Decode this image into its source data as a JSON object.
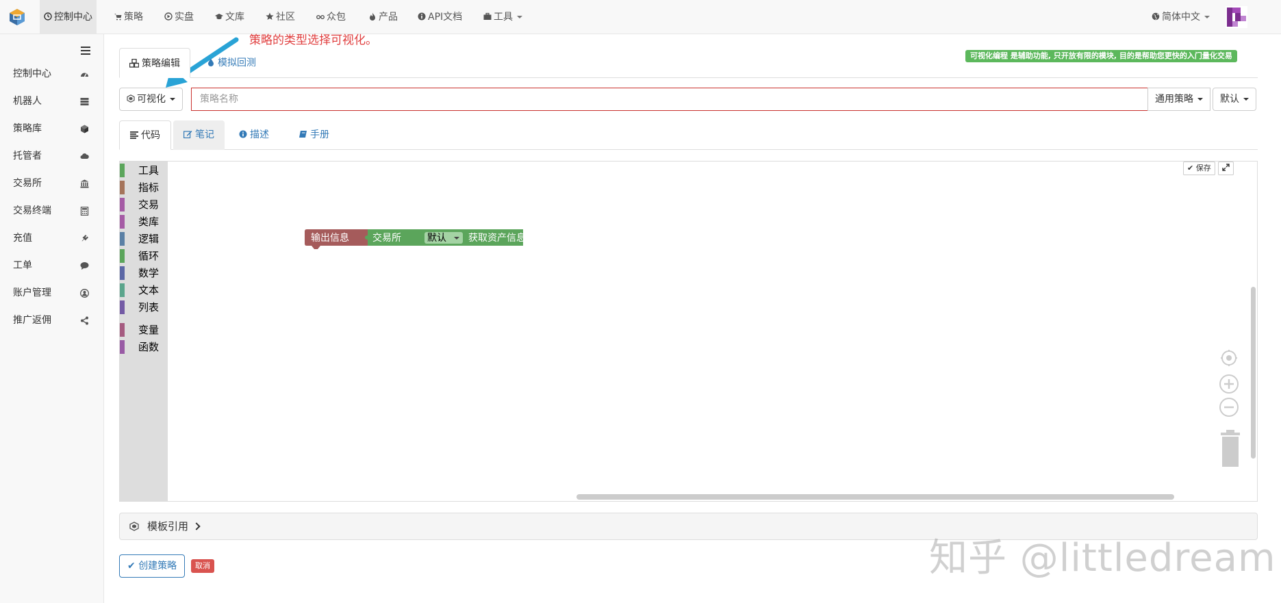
{
  "topnav": {
    "items": [
      {
        "label": "控制中心",
        "icon": "dashboard-icon"
      },
      {
        "label": "策略",
        "icon": "cart-icon"
      },
      {
        "label": "实盘",
        "icon": "play-circle-icon"
      },
      {
        "label": "文库",
        "icon": "graduation-cap-icon"
      },
      {
        "label": "社区",
        "icon": "star-icon"
      },
      {
        "label": "众包",
        "icon": "glasses-icon"
      },
      {
        "label": "产品",
        "icon": "fire-icon"
      },
      {
        "label": "API文档",
        "icon": "info-icon"
      },
      {
        "label": "工具",
        "icon": "briefcase-icon"
      }
    ],
    "language": "简体中文"
  },
  "sidebar": {
    "items": [
      {
        "label": "控制中心",
        "icon": "dashboard-icon"
      },
      {
        "label": "机器人",
        "icon": "server-icon"
      },
      {
        "label": "策略库",
        "icon": "cube-icon"
      },
      {
        "label": "托管者",
        "icon": "cloud-icon"
      },
      {
        "label": "交易所",
        "icon": "bank-icon"
      },
      {
        "label": "交易终端",
        "icon": "calculator-icon"
      },
      {
        "label": "充值",
        "icon": "plug-icon"
      },
      {
        "label": "工单",
        "icon": "comment-icon"
      },
      {
        "label": "账户管理",
        "icon": "user-circle-icon"
      },
      {
        "label": "推广返佣",
        "icon": "share-icon"
      }
    ]
  },
  "annotation": "策略的类型选择可视化。",
  "edit_tabs": {
    "editor": "策略编辑",
    "backtest": "模拟回测"
  },
  "notice_badge": "可视化编程 是辅助功能, 只开放有限的模块, 目的是帮助您更快的入门量化交易",
  "form": {
    "type_button": "可视化",
    "name_placeholder": "策略名称",
    "category_button": "通用策略",
    "default_button": "默认"
  },
  "code_tabs": {
    "code": "代码",
    "notes": "笔记",
    "description": "描述",
    "manual": "手册"
  },
  "toolbox": [
    {
      "label": "工具",
      "color": "#5ba55b"
    },
    {
      "label": "指标",
      "color": "#a5745b"
    },
    {
      "label": "交易",
      "color": "#a55ba5"
    },
    {
      "label": "类库",
      "color": "#a55ba5"
    },
    {
      "label": "逻辑",
      "color": "#5b80a5"
    },
    {
      "label": "循环",
      "color": "#5ba55b"
    },
    {
      "label": "数学",
      "color": "#5b67a5"
    },
    {
      "label": "文本",
      "color": "#5ba58c"
    },
    {
      "label": "列表",
      "color": "#745ba5"
    },
    {
      "label": "变量",
      "color": "#a55b80"
    },
    {
      "label": "函数",
      "color": "#995ba5"
    }
  ],
  "blocks": {
    "output": "输出信息",
    "exchange": "交易所",
    "dropdown": "默认",
    "get_account": "获取资产信息",
    "output_color": "#a55b5b",
    "exchange_color": "#5ba55b"
  },
  "workspace": {
    "save": "保存"
  },
  "template_ref": "模板引用",
  "actions": {
    "create": "创建策略",
    "cancel": "取消"
  },
  "watermark": "知乎 @littledream"
}
